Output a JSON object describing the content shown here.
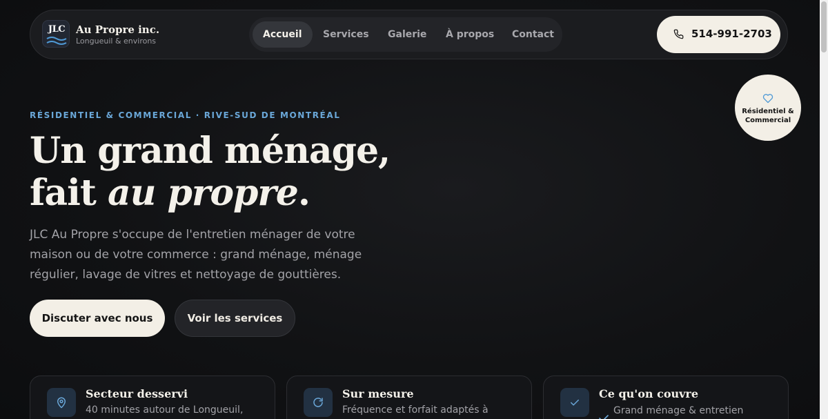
{
  "brand": {
    "logo_text": "JLC",
    "name": "Au Propre inc.",
    "subtitle": "Longueuil & environs"
  },
  "nav": {
    "items": [
      {
        "label": "Accueil",
        "active": true
      },
      {
        "label": "Services",
        "active": false
      },
      {
        "label": "Galerie",
        "active": false
      },
      {
        "label": "À propos",
        "active": false
      },
      {
        "label": "Contact",
        "active": false
      }
    ]
  },
  "phone": {
    "label": "514-991-2703",
    "icon": "phone-icon"
  },
  "badge": {
    "icon": "heart-icon",
    "line1": "Résidentiel &",
    "line2": "Commercial"
  },
  "hero": {
    "eyebrow": "RÉSIDENTIEL & COMMERCIAL · RIVE-SUD DE MONTRÉAL",
    "title_line1": "Un grand ménage,",
    "title_line2_prefix": "fait ",
    "title_line2_em": "au propre",
    "title_line2_suffix": ".",
    "description": "JLC Au Propre s'occupe de l'entretien ménager de votre maison ou de votre commerce : grand ménage, ménage régulier, lavage de vitres et nettoyage de gouttières.",
    "primary_button": "Discuter avec nous",
    "secondary_button": "Voir les services"
  },
  "cards": [
    {
      "icon": "map-pin-icon",
      "title": "Secteur desservi",
      "text": "40 minutes autour de Longueuil,"
    },
    {
      "icon": "refresh-icon",
      "title": "Sur mesure",
      "text": "Fréquence et forfait adaptés à"
    },
    {
      "icon": "check-icon",
      "title": "Ce qu'on couvre",
      "text": "Grand ménage & entretien"
    }
  ],
  "colors": {
    "accent": "#6aa7d8",
    "cream": "#f3efe6",
    "background": "#111214"
  }
}
